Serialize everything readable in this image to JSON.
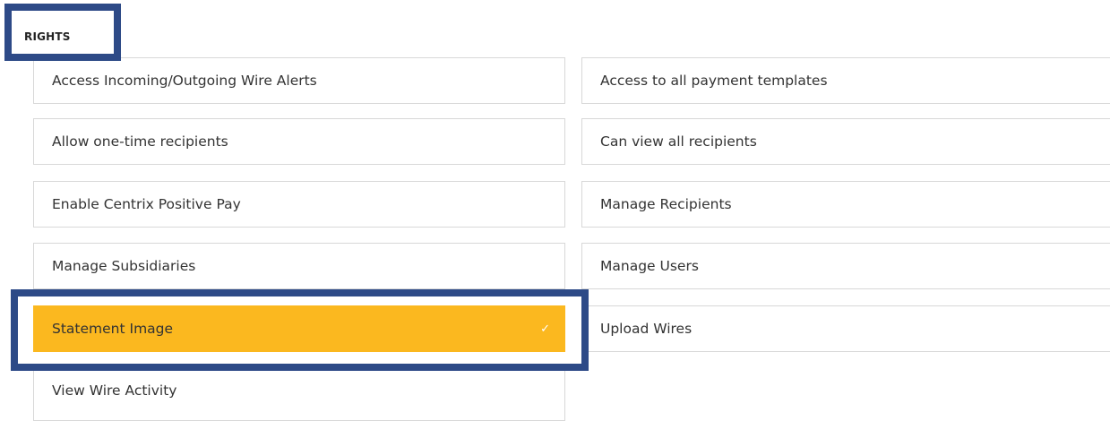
{
  "section": {
    "heading": "RIGHTS"
  },
  "rights": {
    "items": [
      {
        "label": "Access Incoming/Outgoing Wire Alerts",
        "selected": false
      },
      {
        "label": "Access to all payment templates",
        "selected": false
      },
      {
        "label": "Allow one-time recipients",
        "selected": false
      },
      {
        "label": "Can view all recipients",
        "selected": false
      },
      {
        "label": "Enable Centrix Positive Pay",
        "selected": false
      },
      {
        "label": "Manage Recipients",
        "selected": false
      },
      {
        "label": "Manage Subsidiaries",
        "selected": false
      },
      {
        "label": "Manage Users",
        "selected": false
      },
      {
        "label": "Statement Image",
        "selected": true
      },
      {
        "label": "Upload Wires",
        "selected": false
      },
      {
        "label": "View Wire Activity",
        "selected": false
      }
    ],
    "check_glyph": "✓"
  },
  "colors": {
    "selected_background": "#fbb81f",
    "annotation_border": "#2d4a87",
    "item_border": "#d8d8d8"
  },
  "icons": {
    "selected_indicator": "check-icon"
  }
}
